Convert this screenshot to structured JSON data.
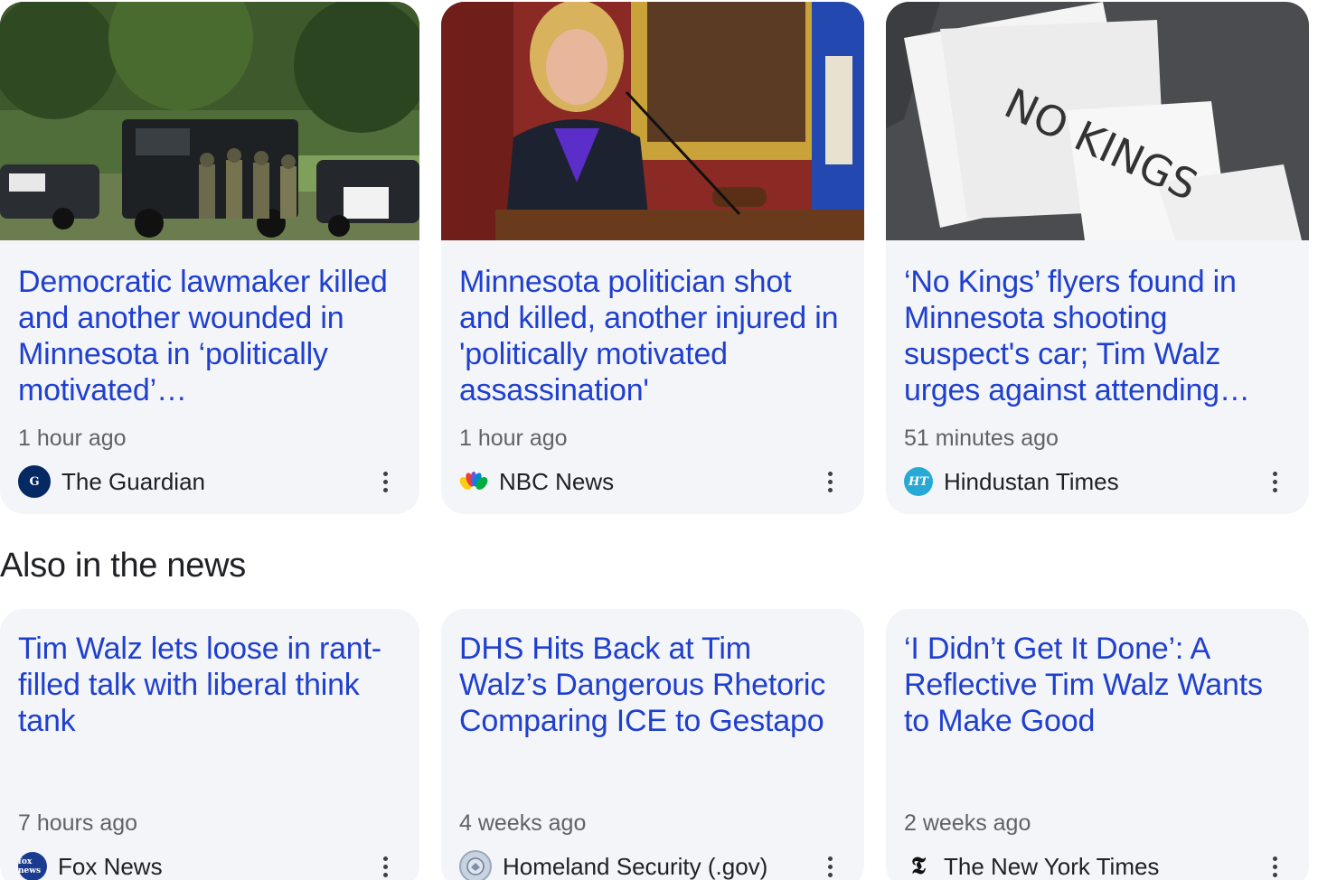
{
  "top_stories": [
    {
      "headline": "Democratic lawmaker killed and another wounded in Minnesota in ‘politically motivated’…",
      "time": "1 hour ago",
      "source": "The Guardian",
      "image_icon": "police-armored-vehicle-image"
    },
    {
      "headline": "Minnesota politician shot and killed, another injured in 'politically motivated assassination'",
      "time": "1 hour ago",
      "source": "NBC News",
      "image_icon": "politician-at-podium-image"
    },
    {
      "headline": "‘No Kings’ flyers found in Minnesota shooting suspect's car; Tim Walz urges against attending…",
      "time": "51 minutes ago",
      "source": "Hindustan Times",
      "image_icon": "no-kings-flyers-image",
      "flyer_text": "NO KINGS"
    }
  ],
  "also_in_the_news": {
    "title": "Also in the news",
    "items": [
      {
        "headline": "Tim Walz lets loose in rant-filled talk with liberal think tank",
        "time": "7 hours ago",
        "source": "Fox News"
      },
      {
        "headline": "DHS Hits Back at Tim Walz’s Dangerous Rhetoric Comparing ICE to Gestapo",
        "time": "4 weeks ago",
        "source": "Homeland Security (.gov)"
      },
      {
        "headline": "‘I Didn’t Get It Done’: A Reflective Tim Walz Wants to Make Good",
        "time": "2 weeks ago",
        "source": "The New York Times"
      }
    ]
  },
  "logos": {
    "guardian": "G",
    "hindustan": "HT",
    "fox": "fox news",
    "nyt": "𝕿"
  },
  "colors": {
    "headline": "#1f3fcf",
    "card_bg": "#f3f5f8",
    "meta_text": "#5f6368"
  }
}
